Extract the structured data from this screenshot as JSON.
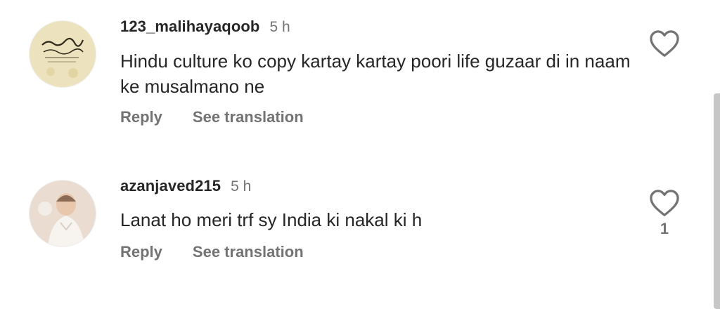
{
  "comments": [
    {
      "username": "123_malihayaqoob",
      "time": "5 h",
      "text": "Hindu culture ko copy kartay kartay poori life guzaar di in naam ke musalmano ne",
      "reply_label": "Reply",
      "translate_label": "See translation",
      "avatar_icon": "calligraphy-avatar",
      "like_count": ""
    },
    {
      "username": "azanjaved215",
      "time": "5 h",
      "text": "Lanat ho meri trf sy India ki nakal ki h",
      "reply_label": "Reply",
      "translate_label": "See translation",
      "avatar_icon": "child-photo-avatar",
      "like_count": "1"
    }
  ],
  "colors": {
    "text_primary": "#262626",
    "text_secondary": "#737373",
    "scrollbar": "#c6c6c6"
  }
}
